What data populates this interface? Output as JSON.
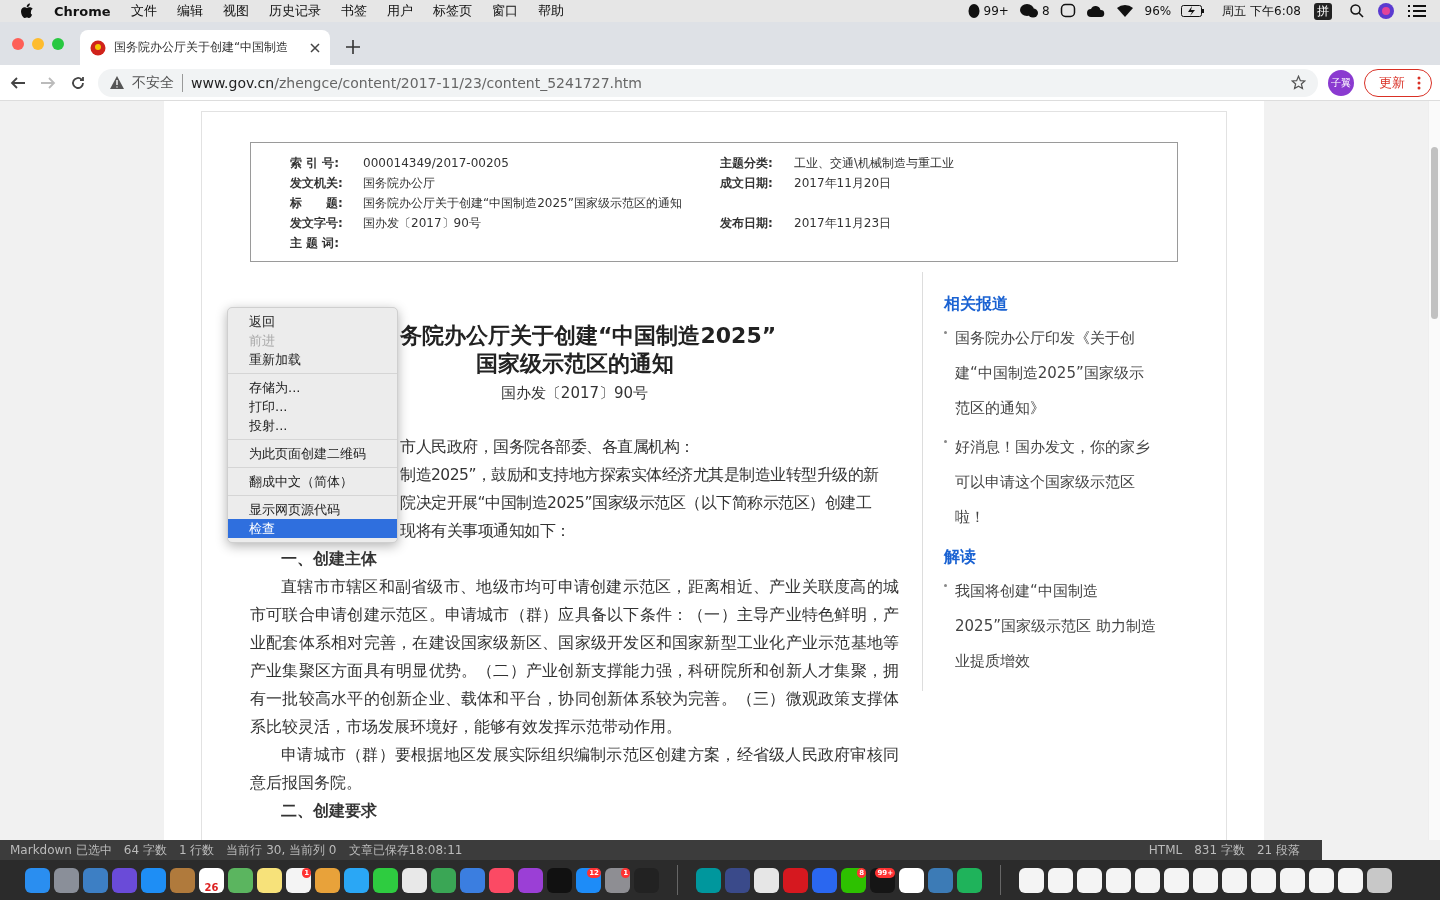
{
  "menubar": {
    "app": "Chrome",
    "menus": [
      "文件",
      "编辑",
      "视图",
      "历史记录",
      "书签",
      "用户",
      "标签页",
      "窗口",
      "帮助"
    ],
    "qq_count": "99+",
    "wechat_count": "8",
    "battery": "96%",
    "clock": "周五 下午6:08",
    "ime": "拼"
  },
  "tab": {
    "title": "国务院办公厅关于创建“中国制造"
  },
  "address": {
    "security": "不安全",
    "host": "www.gov.cn",
    "path": "/zhengce/content/2017-11/23/content_5241727.htm"
  },
  "profile": "子翼",
  "update_button": "更新",
  "info": [
    {
      "label": "索 引 号:",
      "value": "000014349/2017-00205",
      "label_2": "主题分类:",
      "value_2": "工业、交通\\机械制造与重工业"
    },
    {
      "label": "发文机关:",
      "value": "国务院办公厅",
      "label_2": "成文日期:",
      "value_2": "2017年11月20日"
    },
    {
      "label": "标　　题:",
      "value": "国务院办公厅关于创建“中国制造2025”国家级示范区的通知"
    },
    {
      "label": "发文字号:",
      "value": "国办发〔2017〕90号",
      "label_2": "发布日期:",
      "value_2": "2017年11月23日"
    },
    {
      "label": "主 题 词:"
    }
  ],
  "article": {
    "title_lines": [
      "务院办公厅关于创建“中国制造2025”",
      "国家级示范区的通知"
    ],
    "doc_number": "国办发〔2017〕90号",
    "paragraphs": [
      {
        "kind": "partial",
        "text": "市人民政府，国务院各部委、各直属机构："
      },
      {
        "kind": "partial",
        "text": "制造2025”，鼓励和支持地方探索实体经济尤其是制造业转型升级的新"
      },
      {
        "kind": "partial",
        "text": "院决定开展“中国制造2025”国家级示范区（以下简称示范区）创建工"
      },
      {
        "kind": "partial",
        "text": "现将有关事项通知如下："
      },
      {
        "kind": "heading",
        "text": "一、创建主体"
      },
      {
        "kind": "body",
        "text": "直辖市市辖区和副省级市、地级市均可申请创建示范区，距离相近、产业关联度高的城市可联合申请创建示范区。申请城市（群）应具备以下条件：（一）主导产业特色鲜明，产业配套体系相对完善，在建设国家级新区、国家级开发区和国家新型工业化产业示范基地等产业集聚区方面具有明显优势。（二）产业创新支撑能力强，科研院所和创新人才集聚，拥有一批较高水平的创新企业、载体和平台，协同创新体系较为完善。（三）微观政策支撑体系比较灵活，市场发展环境好，能够有效发挥示范带动作用。"
      },
      {
        "kind": "body",
        "text": "申请城市（群）要根据地区发展实际组织编制示范区创建方案，经省级人民政府审核同意后报国务院。"
      },
      {
        "kind": "heading",
        "text": "二、创建要求"
      }
    ]
  },
  "sidebar": [
    {
      "heading": "相关报道",
      "items": [
        "国务院办公厅印发《关于创建“中国制造2025”国家级示范区的通知》",
        "好消息！国办发文，你的家乡可以申请这个国家级示范区啦！"
      ]
    },
    {
      "heading": "解读",
      "items": [
        "我国将创建“中国制造2025”国家级示范区 助力制造业提质增效"
      ]
    }
  ],
  "context_menu": [
    [
      {
        "label": "返回",
        "disabled": false,
        "selected": false
      },
      {
        "label": "前进",
        "disabled": true,
        "selected": false
      },
      {
        "label": "重新加载",
        "disabled": false,
        "selected": false
      }
    ],
    [
      {
        "label": "存储为...",
        "disabled": false,
        "selected": false
      },
      {
        "label": "打印...",
        "disabled": false,
        "selected": false
      },
      {
        "label": "投射...",
        "disabled": false,
        "selected": false
      }
    ],
    [
      {
        "label": "为此页面创建二维码",
        "disabled": false,
        "selected": false
      }
    ],
    [
      {
        "label": "翻成中文（简体）",
        "disabled": false,
        "selected": false
      }
    ],
    [
      {
        "label": "显示网页源代码",
        "disabled": false,
        "selected": false
      },
      {
        "label": "检查",
        "disabled": false,
        "selected": true
      }
    ]
  ],
  "status_bar": {
    "left": [
      "Markdown 已选中",
      "64 字数",
      "1 行数",
      "当前行 30, 当前列 0",
      "文章已保存18:08:11"
    ],
    "right": [
      "HTML",
      "831 字数",
      "21 段落"
    ]
  },
  "dock": [
    {
      "color": "#2a8ef0"
    },
    {
      "color": "#8a8f99"
    },
    {
      "color": "#3d7fc4"
    },
    {
      "color": "#6a4bd8"
    },
    {
      "color": "#1e8ef5"
    },
    {
      "color": "#b07a3c"
    },
    {
      "color": "#ffffff",
      "label": "26"
    },
    {
      "color": "#5bb55f"
    },
    {
      "color": "#f7e27a"
    },
    {
      "color": "#f4f4f4",
      "badge": "1"
    },
    {
      "color": "#e8a23a"
    },
    {
      "color": "#2aa7f5"
    },
    {
      "color": "#2ecc40"
    },
    {
      "color": "#e8e8e8"
    },
    {
      "color": "#3aa655"
    },
    {
      "color": "#3b7ee0"
    },
    {
      "color": "#fb4a64"
    },
    {
      "color": "#9b3fd6"
    },
    {
      "color": "#111111"
    },
    {
      "color": "#1d8cf8",
      "badge": "12"
    },
    {
      "color": "#8e8e93",
      "badge": "1"
    },
    {
      "color": "#222222"
    },
    {
      "kind": "divider"
    },
    {
      "color": "#00979d"
    },
    {
      "color": "#3a4a8a"
    },
    {
      "color": "#e6e6e6"
    },
    {
      "color": "#d6181f"
    },
    {
      "color": "#2a67f0"
    },
    {
      "color": "#2dc100",
      "badge": "8"
    },
    {
      "color": "#151515",
      "badge": "99+"
    },
    {
      "color": "#ffffff"
    },
    {
      "color": "#3c7bb6"
    },
    {
      "color": "#1fb35b"
    },
    {
      "kind": "divider"
    },
    {
      "color": "#f4f4f4"
    },
    {
      "color": "#f4f4f4"
    },
    {
      "color": "#f4f4f4"
    },
    {
      "color": "#f4f4f4"
    },
    {
      "color": "#f4f4f4"
    },
    {
      "color": "#f4f4f4"
    },
    {
      "color": "#f4f4f4"
    },
    {
      "color": "#f4f4f4"
    },
    {
      "color": "#f4f4f4"
    },
    {
      "color": "#f4f4f4"
    },
    {
      "color": "#f4f4f4"
    },
    {
      "color": "#f4f4f4"
    },
    {
      "color": "#c8c8c8"
    }
  ]
}
